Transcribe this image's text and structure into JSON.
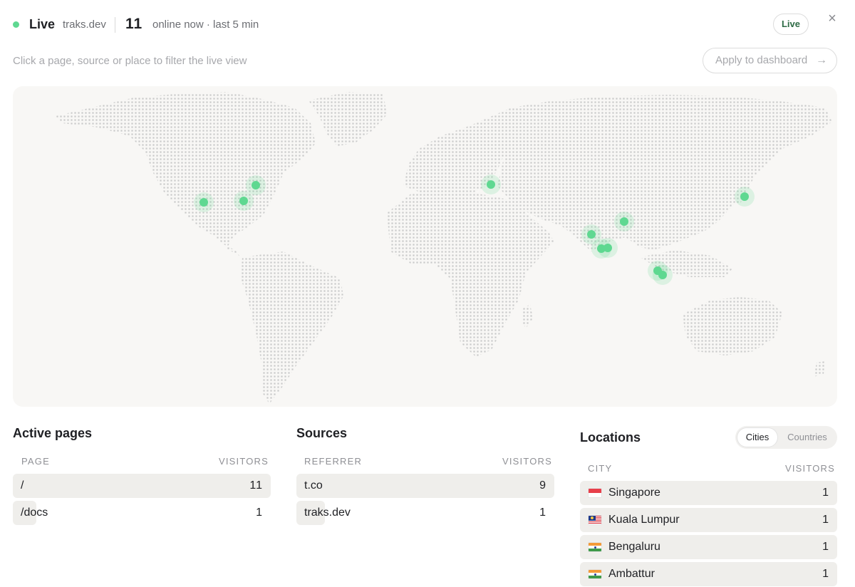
{
  "header": {
    "live_label": "Live",
    "site": "traks.dev",
    "online_count": "11",
    "online_text": "online now · last 5 min",
    "live_pill": "Live",
    "close_icon": "×"
  },
  "filter_hint": "Click a page, source or place to filter the live view",
  "apply_button": {
    "label": "Apply to dashboard",
    "icon": "→"
  },
  "colors": {
    "accent": "#5fd891",
    "row_bar": "#efeeeb",
    "map_bg": "#f8f7f5",
    "map_dot": "#c9c9c9"
  },
  "active_pages": {
    "title": "Active pages",
    "col_page": "PAGE",
    "col_visitors": "VISITORS",
    "rows": [
      {
        "label": "/",
        "value": "11",
        "share": 1.0
      },
      {
        "label": "/docs",
        "value": "1",
        "share": 0.09
      }
    ]
  },
  "sources": {
    "title": "Sources",
    "col_referrer": "REFERRER",
    "col_visitors": "VISITORS",
    "rows": [
      {
        "label": "t.co",
        "value": "9",
        "share": 1.0
      },
      {
        "label": "traks.dev",
        "value": "1",
        "share": 0.11
      }
    ]
  },
  "locations": {
    "title": "Locations",
    "tabs": [
      "Cities",
      "Countries"
    ],
    "active_tab": "Cities",
    "col_city": "CITY",
    "col_visitors": "VISITORS",
    "rows": [
      {
        "label": "Singapore",
        "value": "1",
        "flag": "singapore-flag-icon"
      },
      {
        "label": "Kuala Lumpur",
        "value": "1",
        "flag": "malaysia-flag-icon"
      },
      {
        "label": "Bengaluru",
        "value": "1",
        "flag": "india-flag-icon"
      },
      {
        "label": "Ambattur",
        "value": "1",
        "flag": "india-flag-icon"
      }
    ]
  }
}
